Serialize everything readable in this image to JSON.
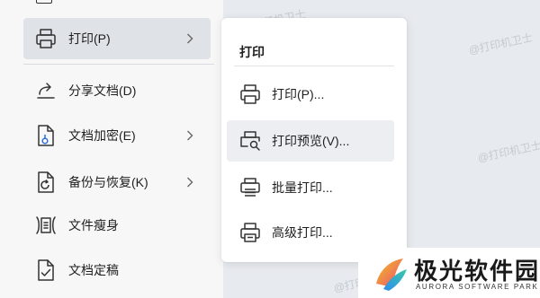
{
  "file_menu": {
    "items": [
      {
        "label": "打印(P)",
        "icon": "printer-icon",
        "has_submenu": true
      },
      {
        "label": "分享文档(D)",
        "icon": "share-icon",
        "has_submenu": false
      },
      {
        "label": "文档加密(E)",
        "icon": "encrypt-doc-icon",
        "has_submenu": true
      },
      {
        "label": "备份与恢复(K)",
        "icon": "backup-icon",
        "has_submenu": true
      },
      {
        "label": "文件瘦身",
        "icon": "compress-file-icon",
        "has_submenu": false
      },
      {
        "label": "文档定稿",
        "icon": "finalize-doc-icon",
        "has_submenu": false
      }
    ]
  },
  "submenu": {
    "title": "打印",
    "items": [
      {
        "label": "打印(P)...",
        "icon": "printer-icon"
      },
      {
        "label": "打印预览(V)...",
        "icon": "print-preview-icon"
      },
      {
        "label": "批量打印...",
        "icon": "batch-print-icon"
      },
      {
        "label": "高级打印...",
        "icon": "advanced-print-icon"
      }
    ]
  },
  "watermark": {
    "text": "@打印机卫士"
  },
  "logo": {
    "name": "极光软件园",
    "subtitle": "AURORA SOFTWARE PARK"
  },
  "colors": {
    "menu_bg": "#f7f7f8",
    "active_bg": "#dfe2e6",
    "hover_bg": "#eceef1",
    "submenu_bg": "#ffffff"
  }
}
